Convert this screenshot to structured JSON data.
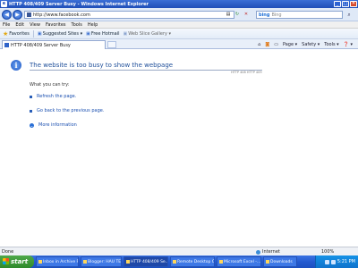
{
  "window": {
    "title": "HTTP 408/409 Server Busy - Windows Internet Explorer"
  },
  "address": {
    "url": "http://www.facebook.com"
  },
  "search": {
    "provider": "bing",
    "placeholder": "Bing"
  },
  "menu": [
    "File",
    "Edit",
    "View",
    "Favorites",
    "Tools",
    "Help"
  ],
  "favorites": {
    "label": "Favorites",
    "items": [
      "Suggested Sites ▾",
      "Free Hotmail",
      "Web Slice Gallery ▾"
    ]
  },
  "tab": {
    "label": "HTTP 408/409 Server Busy"
  },
  "commands": [
    "Page ▾",
    "Safety ▾",
    "Tools ▾",
    "❓ ▾"
  ],
  "content": {
    "heading": "The website is too busy to show the webpage",
    "error_code": "HTTP 408 HTTP 409",
    "try_heading": "What you can try:",
    "options": [
      "Refresh the page.",
      "Go back to the previous page.",
      "More information"
    ]
  },
  "status": {
    "left": "Done",
    "zone": "Internet",
    "zoom": "100%"
  },
  "taskbar": {
    "start": "start",
    "tasks": [
      "Inbox in Archive F...",
      "Blogger: HAU TEB...",
      "HTTP 408/409 Se...",
      "Remote Desktop C...",
      "Microsoft Excel -...",
      "Downloads"
    ],
    "clock": "5:21 PM"
  },
  "colors": {
    "accent": "#1f4f9a",
    "link": "#1a4fb0",
    "taskbar": "#245bd0",
    "start": "#2f8a2b"
  }
}
